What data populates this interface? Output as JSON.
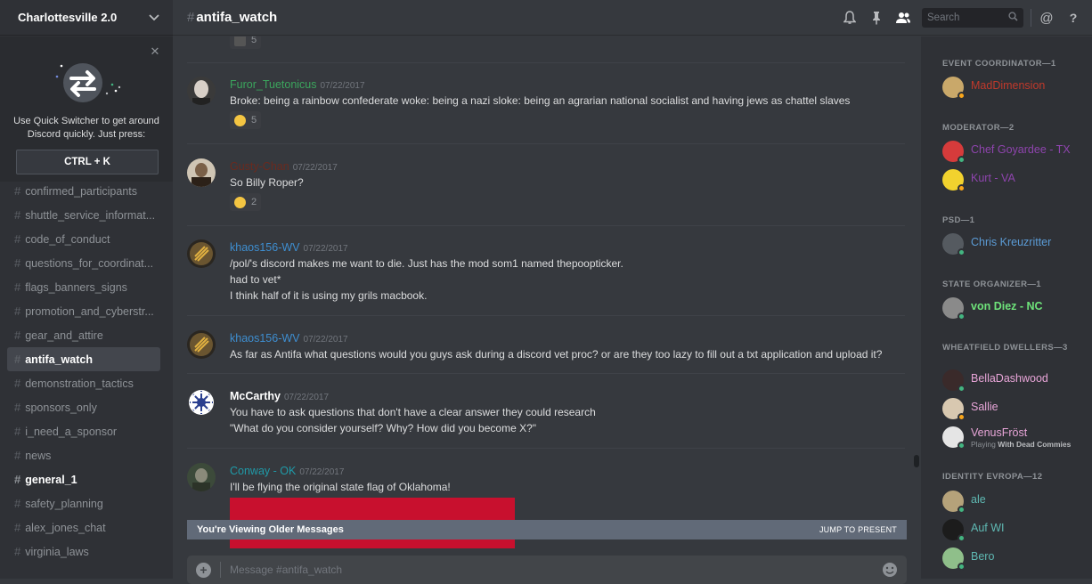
{
  "server": {
    "name": "Charlottesville 2.0"
  },
  "quick_switcher": {
    "tip": "Use Quick Switcher to get around Discord quickly. Just press:",
    "shortcut": "CTRL + K"
  },
  "channels": [
    {
      "name": "confirmed_participants"
    },
    {
      "name": "shuttle_service_informat..."
    },
    {
      "name": "code_of_conduct"
    },
    {
      "name": "questions_for_coordinat..."
    },
    {
      "name": "flags_banners_signs"
    },
    {
      "name": "promotion_and_cyberstr..."
    },
    {
      "name": "gear_and_attire"
    },
    {
      "name": "antifa_watch"
    },
    {
      "name": "demonstration_tactics"
    },
    {
      "name": "sponsors_only"
    },
    {
      "name": "i_need_a_sponsor"
    },
    {
      "name": "news"
    },
    {
      "name": "general_1"
    },
    {
      "name": "safety_planning"
    },
    {
      "name": "alex_jones_chat"
    },
    {
      "name": "virginia_laws"
    }
  ],
  "header": {
    "hash": "#",
    "channel": "antifa_watch",
    "search_placeholder": "Search"
  },
  "top_partial_reaction": {
    "count": "5"
  },
  "messages": [
    {
      "user": "Furor_Tuetonicus",
      "time": "07/22/2017",
      "color": "#3ba55d",
      "lines": [
        "Broke: being a rainbow confederate woke: being a nazi sloke: being an agrarian national socialist and having jews as chattel slaves"
      ],
      "reaction": "5"
    },
    {
      "user": "Gusty-Chan",
      "time": "07/22/2017",
      "color": "#6b2a1e",
      "lines": [
        "So Billy Roper?"
      ],
      "reaction": "2"
    },
    {
      "user": "khaos156-WV",
      "time": "07/22/2017",
      "color": "#3e8ed0",
      "lines": [
        "/pol/'s discord makes me want to die. Just has the mod som1 named thepoopticker.",
        "had to vet*",
        "I think half of it is using my grils macbook."
      ]
    },
    {
      "user": "khaos156-WV",
      "time": "07/22/2017",
      "color": "#3e8ed0",
      "lines": [
        "As far as Antifa what questions would you guys ask during a discord vet proc? or are they too lazy to fill out a txt application and upload it?"
      ]
    },
    {
      "user": "McCarthy",
      "time": "07/22/2017",
      "color": "#ffffff",
      "lines": [
        "You have to ask questions that don't have a clear answer they could research",
        "\"What do you consider yourself? Why? How did you become X?\""
      ]
    },
    {
      "user": "Conway - OK",
      "time": "07/22/2017",
      "color": "#1f9aa8",
      "lines": [
        "I'll be flying the original state flag of Oklahoma!"
      ]
    }
  ],
  "older_bar": {
    "text": "You're Viewing Older Messages",
    "jump": "JUMP TO PRESENT"
  },
  "composer": {
    "placeholder": "Message #antifa_watch",
    "plus": "+"
  },
  "members": {
    "groups": [
      {
        "title": "EVENT COORDINATOR—1"
      },
      {
        "title": "MODERATOR—2"
      },
      {
        "title": "PSD—1"
      },
      {
        "title": "STATE ORGANIZER—1"
      },
      {
        "title": "WHEATFIELD DWELLERS—3"
      },
      {
        "title": "IDENTITY EVROPA—12"
      }
    ],
    "list": [
      {
        "name": "MadDimension",
        "color": "#c0392b",
        "status": "#faa61a"
      },
      {
        "name": "Chef Goyardee - TX",
        "color": "#8e44ad",
        "status": "#43b581"
      },
      {
        "name": "Kurt - VA",
        "color": "#8e44ad",
        "status": "#faa61a"
      },
      {
        "name": "Chris Kreuzritter",
        "color": "#5b9bd5",
        "status": "#43b581"
      },
      {
        "name": "von Diez - NC",
        "color": "#6ee37a",
        "status": "#43b581"
      },
      {
        "name": "BellaDashwood",
        "color": "#e8a5d8",
        "status": "#43b581"
      },
      {
        "name": "Sallie",
        "color": "#e8a5d8",
        "status": "#faa61a"
      },
      {
        "name": "VenusFröst",
        "color": "#e8a5d8",
        "status": "#43b581",
        "activity_prefix": "Playing",
        "activity": "With Dead Commies"
      },
      {
        "name": "ale",
        "color": "#5fb9b3",
        "status": "#43b581"
      },
      {
        "name": "Auf WI",
        "color": "#5fb9b3",
        "status": "#43b581"
      },
      {
        "name": "Bero",
        "color": "#5fb9b3",
        "status": "#43b581"
      }
    ]
  }
}
